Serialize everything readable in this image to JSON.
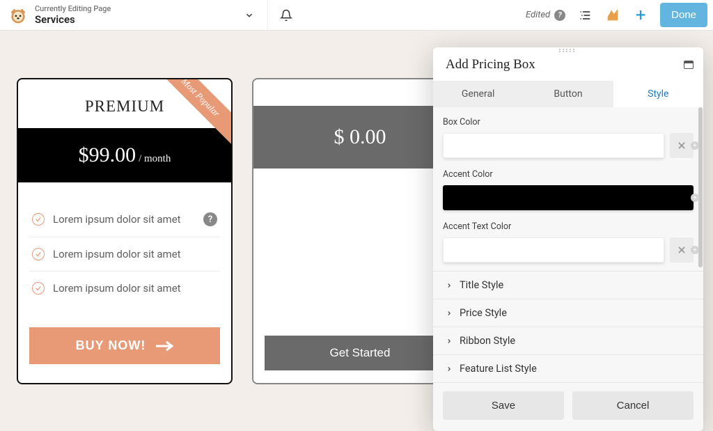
{
  "header": {
    "subtitle": "Currently Editing Page",
    "title": "Services",
    "edited_label": "Edited",
    "done_label": "Done"
  },
  "card_premium": {
    "title": "PREMIUM",
    "ribbon": "Most Popular",
    "price": "$99.00",
    "period": "/ month",
    "features": [
      "Lorem ipsum dolor sit amet",
      "Lorem ipsum dolor sit amet",
      "Lorem ipsum dolor sit amet"
    ],
    "cta": "BUY NOW!"
  },
  "card_blank": {
    "price": "$ 0.00",
    "cta": "Get Started"
  },
  "panel": {
    "title": "Add Pricing Box",
    "tabs": {
      "general": "General",
      "button": "Button",
      "style": "Style"
    },
    "fields": {
      "box_color_label": "Box Color",
      "box_color_value": "#ffffff",
      "accent_color_label": "Accent Color",
      "accent_color_value": "#000000",
      "accent_text_color_label": "Accent Text Color",
      "accent_text_color_value": "#ffffff"
    },
    "accordion": {
      "title_style": "Title Style",
      "price_style": "Price Style",
      "ribbon_style": "Ribbon Style",
      "feature_list_style": "Feature List Style"
    },
    "footer": {
      "save": "Save",
      "cancel": "Cancel"
    }
  }
}
